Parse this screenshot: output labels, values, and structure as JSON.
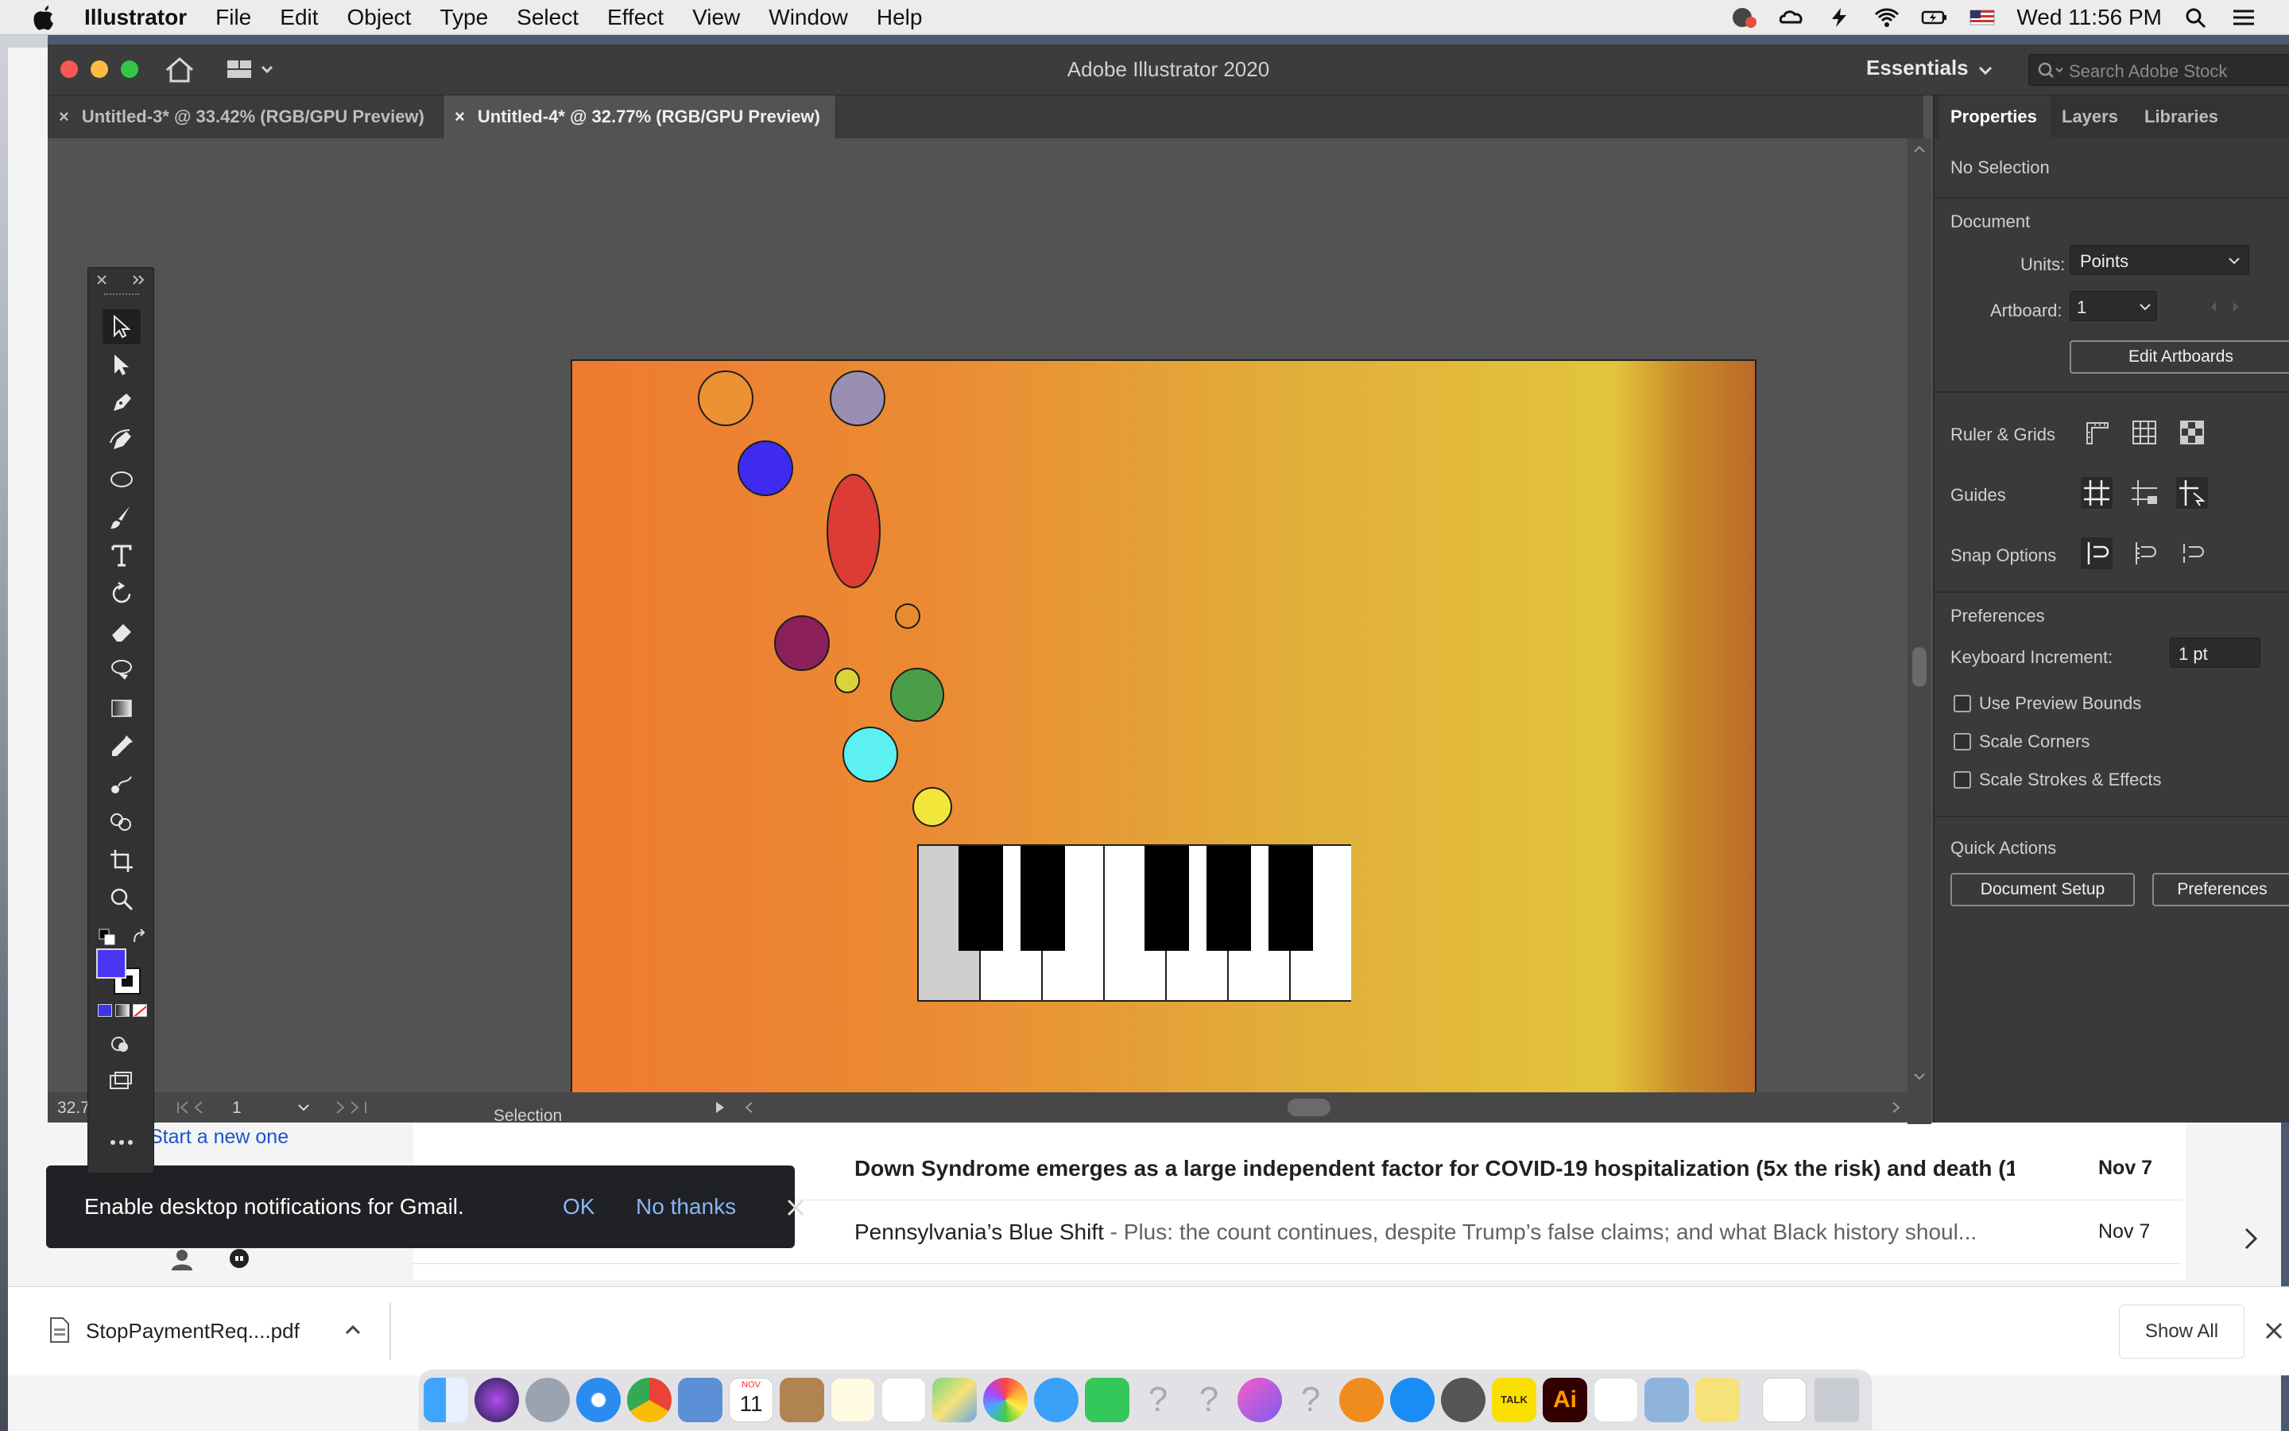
{
  "menubar": {
    "app_name": "Illustrator",
    "items": [
      "File",
      "Edit",
      "Object",
      "Type",
      "Select",
      "Effect",
      "View",
      "Window",
      "Help"
    ],
    "clock": "Wed 11:56 PM"
  },
  "illustrator": {
    "title": "Adobe Illustrator 2020",
    "workspace": "Essentials",
    "search_placeholder": "Search Adobe Stock",
    "tabs": [
      {
        "label": "Untitled-3* @ 33.42% (RGB/GPU Preview)"
      },
      {
        "label": "Untitled-4* @ 32.77% (RGB/GPU Preview)"
      }
    ],
    "status": {
      "zoom": "32.7",
      "page": "1",
      "tool": "Selection"
    },
    "fill_color": "#4a36f0",
    "artboard_gradient": [
      "#ee7b30",
      "#e1ad3a",
      "#e3c43c",
      "#bb6a27"
    ],
    "circles": [
      {
        "color": "#eb9233",
        "shape": "circle"
      },
      {
        "color": "#9a8fb3",
        "shape": "circle"
      },
      {
        "color": "#3f2bf0",
        "shape": "circle"
      },
      {
        "color": "#dc3c33",
        "shape": "ellipse"
      },
      {
        "color": "#e88a2e",
        "shape": "circle"
      },
      {
        "color": "#8b1f5a",
        "shape": "circle"
      },
      {
        "color": "#d9d43a",
        "shape": "circle"
      },
      {
        "color": "#4a9e48",
        "shape": "circle"
      },
      {
        "color": "#5df0f0",
        "shape": "circle"
      },
      {
        "color": "#f2e63a",
        "shape": "circle"
      }
    ]
  },
  "properties": {
    "tabs": [
      "Properties",
      "Layers",
      "Libraries"
    ],
    "no_selection": "No Selection",
    "document_heading": "Document",
    "units_label": "Units:",
    "units_value": "Points",
    "artboard_label": "Artboard:",
    "artboard_value": "1",
    "edit_artboards": "Edit Artboards",
    "ruler_grids": "Ruler & Grids",
    "guides": "Guides",
    "snap_options": "Snap Options",
    "preferences_heading": "Preferences",
    "keyboard_increment_label": "Keyboard Increment:",
    "keyboard_increment_value": "1 pt",
    "checkboxes": [
      "Use Preview Bounds",
      "Scale Corners",
      "Scale Strokes & Effects"
    ],
    "quick_actions": "Quick Actions",
    "document_setup": "Document Setup",
    "preferences_button": "Preferences"
  },
  "gmail": {
    "start_link": "Start a new one",
    "toast": {
      "message": "Enable desktop notifications for Gmail.",
      "ok": "OK",
      "no_thanks": "No thanks"
    },
    "rows": [
      {
        "subject": "Down Syndrome emerges as a large independent factor for COVID-19 hospitalization (5x the risk) and death (1...",
        "snippet": "",
        "date": "Nov 7",
        "bold": true
      },
      {
        "subject": "Pennsylvania’s Blue Shift",
        "snippet": " - Plus: the count continues, despite Trump’s false claims; and what Black history shoul...",
        "date": "Nov 7",
        "bold": false
      }
    ]
  },
  "downloads": {
    "file": "StopPaymentReq....pdf",
    "show_all": "Show All"
  },
  "dock": {
    "calendar_month": "NOV",
    "calendar_day": "11",
    "kakao_label": "TALK",
    "illustrator_label": "Ai"
  }
}
